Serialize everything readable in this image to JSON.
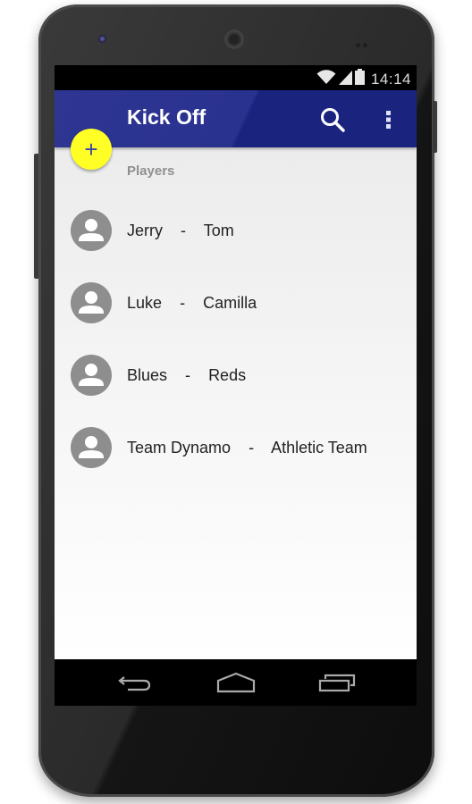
{
  "status_bar": {
    "time": "14:14",
    "icons": [
      "wifi-icon",
      "signal-icon",
      "battery-icon"
    ]
  },
  "app_bar": {
    "title": "Kick Off",
    "actions": [
      "search-icon",
      "overflow-menu-icon"
    ],
    "color": "#1a237e"
  },
  "fab": {
    "label": "+",
    "color": "#ffff26"
  },
  "section": {
    "label": "Players"
  },
  "matches": [
    {
      "home": "Jerry",
      "separator": "-",
      "away": "Tom"
    },
    {
      "home": "Luke",
      "separator": "-",
      "away": "Camilla"
    },
    {
      "home": "Blues",
      "separator": "-",
      "away": "Reds"
    },
    {
      "home": "Team Dynamo",
      "separator": "-",
      "away": "Athletic Team"
    }
  ],
  "nav_bar": {
    "buttons": [
      "back-icon",
      "home-icon",
      "recents-icon"
    ]
  }
}
